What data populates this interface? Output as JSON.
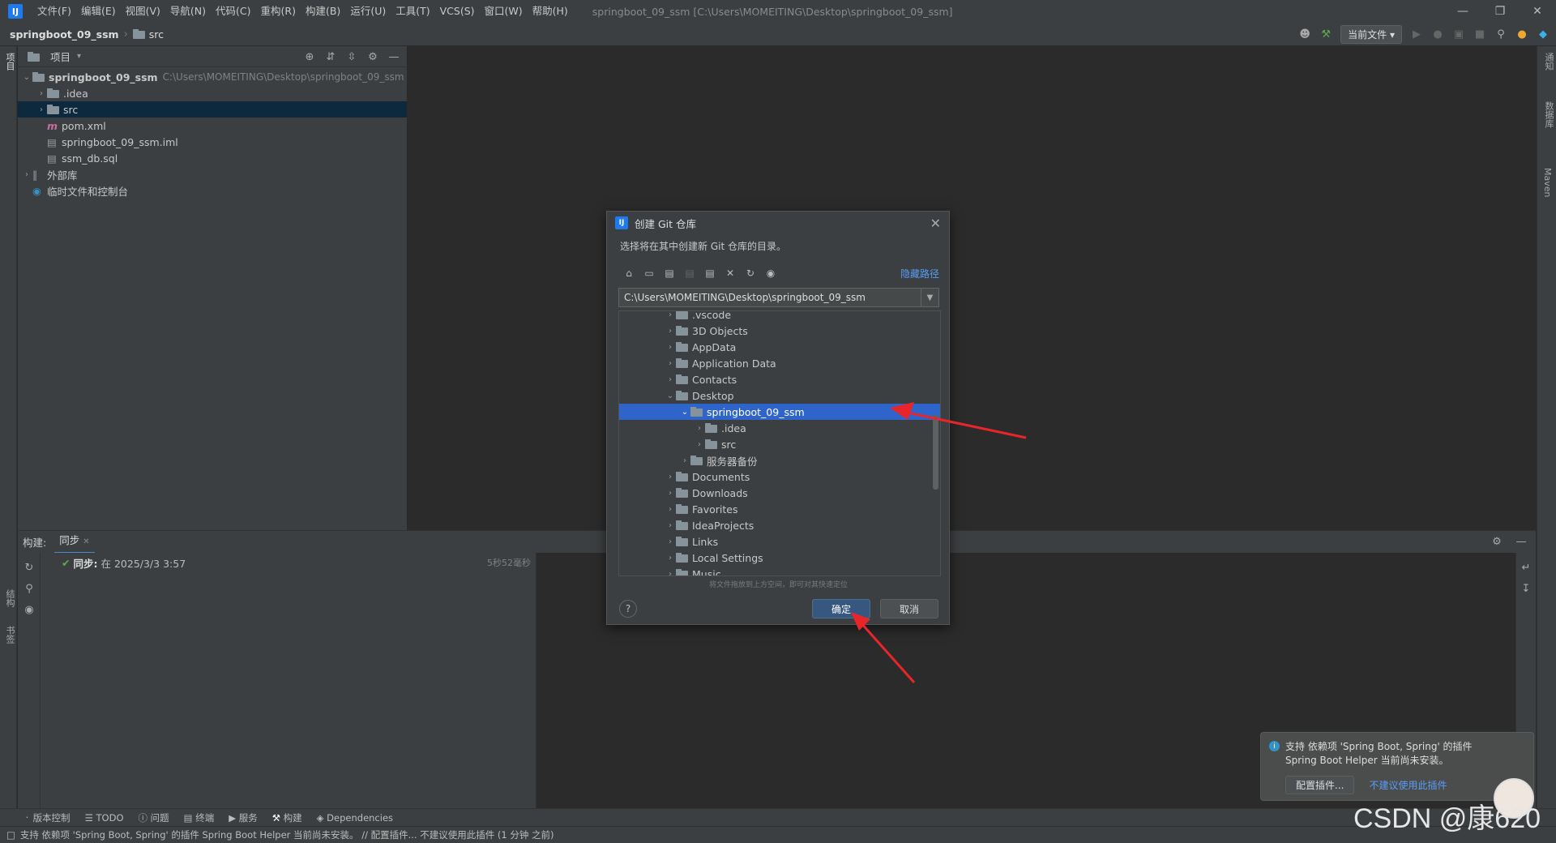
{
  "app": {
    "icon_letter": "IJ",
    "window_title": "springboot_09_ssm [C:\\Users\\MOMEITING\\Desktop\\springboot_09_ssm]"
  },
  "menu": [
    "文件(F)",
    "编辑(E)",
    "视图(V)",
    "导航(N)",
    "代码(C)",
    "重构(R)",
    "构建(B)",
    "运行(U)",
    "工具(T)",
    "VCS(S)",
    "窗口(W)",
    "帮助(H)"
  ],
  "nav": {
    "project": "springboot_09_ssm",
    "folder": "src",
    "run_config": "当前文件"
  },
  "project_panel": {
    "title": "项目",
    "root_name": "springboot_09_ssm",
    "root_path": "C:\\Users\\MOMEITING\\Desktop\\springboot_09_ssm",
    "items": [
      "idea",
      "src",
      "pom.xml",
      "springboot_09_ssm.iml",
      "ssm_db.sql"
    ],
    "external": "外部库",
    "scratch": "临时文件和控制台"
  },
  "left_strip": {
    "project": "项目",
    "structure": "结构",
    "bookmarks": "书签"
  },
  "right_strip": {
    "notifications": "通知",
    "maven": "Maven",
    "database": "数据库"
  },
  "build": {
    "label": "构建:",
    "tab": "同步",
    "sync_label": "同步:",
    "sync_time": "在 2025/3/3 3:57",
    "duration": "5秒52毫秒"
  },
  "dialog": {
    "title": "创建 Git 仓库",
    "subtitle": "选择将在其中创建新 Git 仓库的目录。",
    "hide_path": "隐藏路径",
    "path": "C:\\Users\\MOMEITING\\Desktop\\springboot_09_ssm",
    "tree": [
      ".vscode",
      "3D Objects",
      "AppData",
      "Application Data",
      "Contacts",
      "Desktop",
      "springboot_09_ssm",
      ".idea",
      "src",
      "服务器备份",
      "Documents",
      "Downloads",
      "Favorites",
      "IdeaProjects",
      "Links",
      "Local Settings",
      "Music"
    ],
    "hint": "将文件拖放到上方空间，即可对其快速定位",
    "ok": "确定",
    "cancel": "取消",
    "help": "?"
  },
  "bottom_tabs": [
    "版本控制",
    "TODO",
    "问题",
    "终端",
    "服务",
    "构建",
    "Dependencies"
  ],
  "status_text": "支持 依赖项 'Spring Boot, Spring' 的插件 Spring Boot Helper 当前尚未安装。 // 配置插件...   不建议使用此插件 (1 分钟 之前)",
  "notification": {
    "line1": "支持 依赖项 'Spring Boot, Spring' 的插件",
    "line2": "Spring Boot Helper 当前尚未安装。",
    "configure": "配置插件...",
    "dont_suggest": "不建议使用此插件"
  },
  "watermark": "CSDN @康620",
  "colors": {
    "selection": "#2f65ca",
    "accent_link": "#589df6",
    "arrow": "#e8262a"
  }
}
